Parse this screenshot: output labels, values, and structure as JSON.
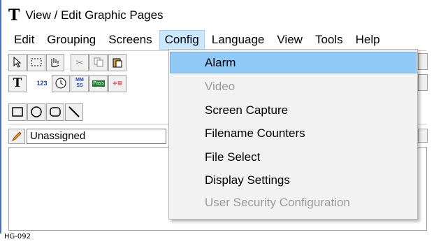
{
  "window": {
    "app_icon": "T",
    "title": "View / Edit Graphic Pages"
  },
  "menubar": {
    "items": [
      "Edit",
      "Grouping",
      "Screens",
      "Config",
      "Language",
      "View",
      "Tools",
      "Help"
    ],
    "active_index": 3
  },
  "toolbar": {
    "row1": [
      "pointer-icon",
      "marquee-select-icon",
      "hand-pan-icon",
      "cut-icon",
      "copy-icon",
      "paste-icon"
    ],
    "row2_text_tool": "T",
    "row2_numeric": "123",
    "row2_mm_ss": "MM SS",
    "row2_pass": "Pass",
    "row3": [
      "rectangle-icon",
      "circle-icon",
      "rounded-rectangle-icon",
      "line-icon"
    ]
  },
  "layer_combo": {
    "value": "Unassigned"
  },
  "config_menu": {
    "items": [
      {
        "label": "Alarm",
        "state": "highlighted"
      },
      {
        "label": "Video",
        "state": "disabled"
      },
      {
        "label": "Screen Capture",
        "state": "enabled"
      },
      {
        "label": "Filename Counters",
        "state": "enabled"
      },
      {
        "label": "File Select",
        "state": "enabled"
      },
      {
        "label": "Display Settings",
        "state": "enabled"
      },
      {
        "label": "User  Security Configuration",
        "state": "disabled"
      }
    ]
  },
  "figure_id": "HG-092",
  "colors": {
    "highlight": "#91c9f7",
    "menu_active": "#cce8ff",
    "disabled_text": "#9a9a9a",
    "window_edge": "#4a6fb5"
  }
}
